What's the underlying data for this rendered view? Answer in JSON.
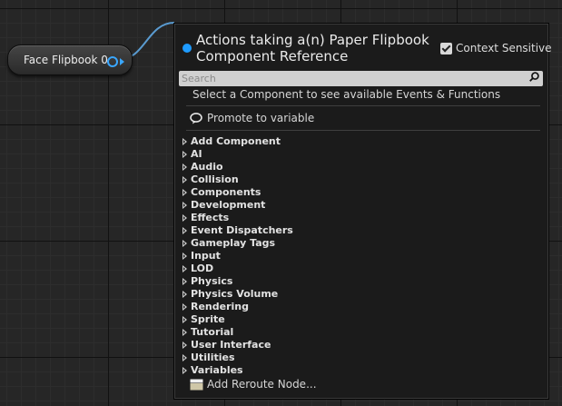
{
  "node": {
    "label": "Face Flipbook 0",
    "pin_color": "#3aa7ff"
  },
  "menu": {
    "title": "Actions taking a(n) Paper Flipbook Component Reference",
    "context_sensitive": {
      "label": "Context Sensitive",
      "checked": true
    },
    "search": {
      "placeholder": "Search",
      "value": ""
    },
    "hint": "Select a Component to see available Events & Functions",
    "promote_label": "Promote to variable",
    "categories": [
      "Add Component",
      "AI",
      "Audio",
      "Collision",
      "Components",
      "Development",
      "Effects",
      "Event Dispatchers",
      "Gameplay Tags",
      "Input",
      "LOD",
      "Physics",
      "Physics Volume",
      "Rendering",
      "Sprite",
      "Tutorial",
      "User Interface",
      "Utilities",
      "Variables"
    ],
    "reroute_label": "Add Reroute Node...",
    "icons": {
      "title_dot": "blue-dot-icon",
      "search": "magnifier-icon",
      "promote": "speech-bubble-icon",
      "expand": "triangle-right-icon",
      "reroute": "reroute-node-icon"
    }
  },
  "colors": {
    "accent": "#1e9bff",
    "menu_bg": "#1b1b1b",
    "graph_bg": "#262626"
  }
}
